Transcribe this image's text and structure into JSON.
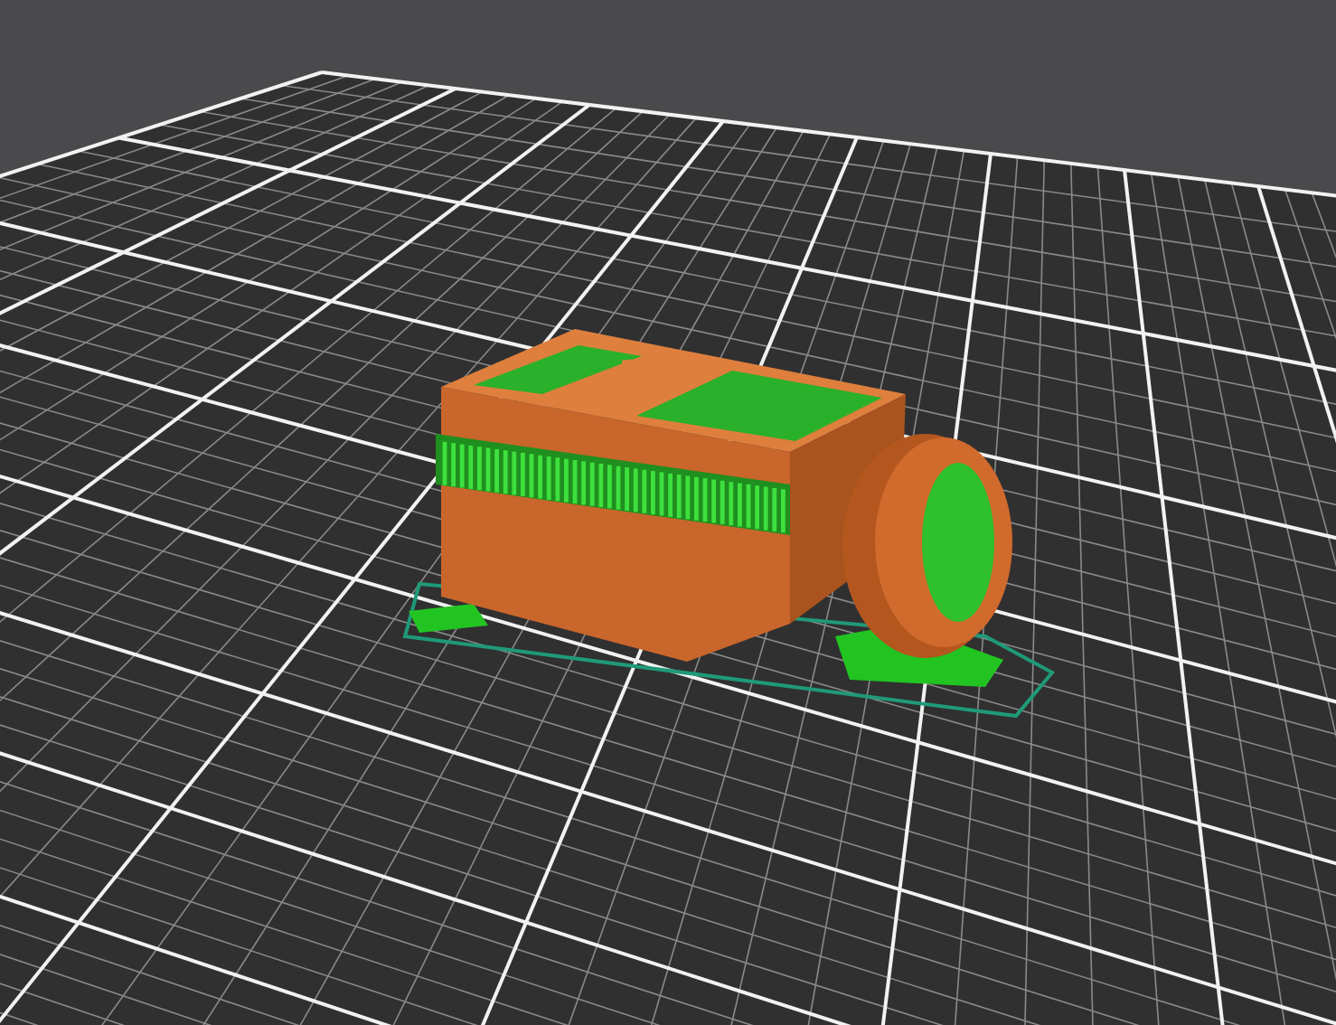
{
  "viewport": {
    "kind": "slicer-preview"
  }
}
